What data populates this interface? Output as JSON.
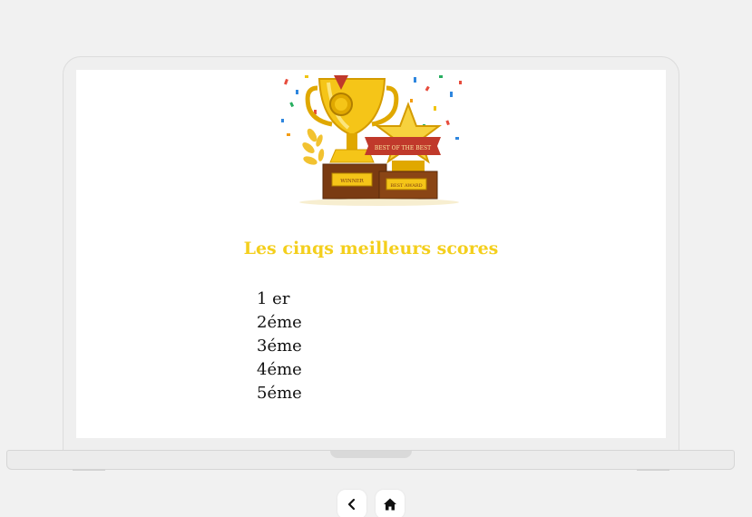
{
  "scores": {
    "title": "Les cinqs meilleurs scores",
    "ranks": [
      "1 er",
      "2éme",
      "3éme",
      "4éme",
      "5éme"
    ]
  },
  "illustration": {
    "icon": "trophy-icon",
    "banner_text": "BEST OF THE BEST",
    "plaque_left": "WINNER",
    "plaque_right": "BEST AWARD",
    "colors": {
      "gold": "#f5c518",
      "red": "#c0392b",
      "wood": "#7a3b12"
    }
  },
  "nav": {
    "back_icon": "chevron-left-icon",
    "home_icon": "home-icon"
  },
  "colors": {
    "title": "#f4cf1d",
    "background": "#f1f1f1",
    "screen": "#ffffff"
  }
}
